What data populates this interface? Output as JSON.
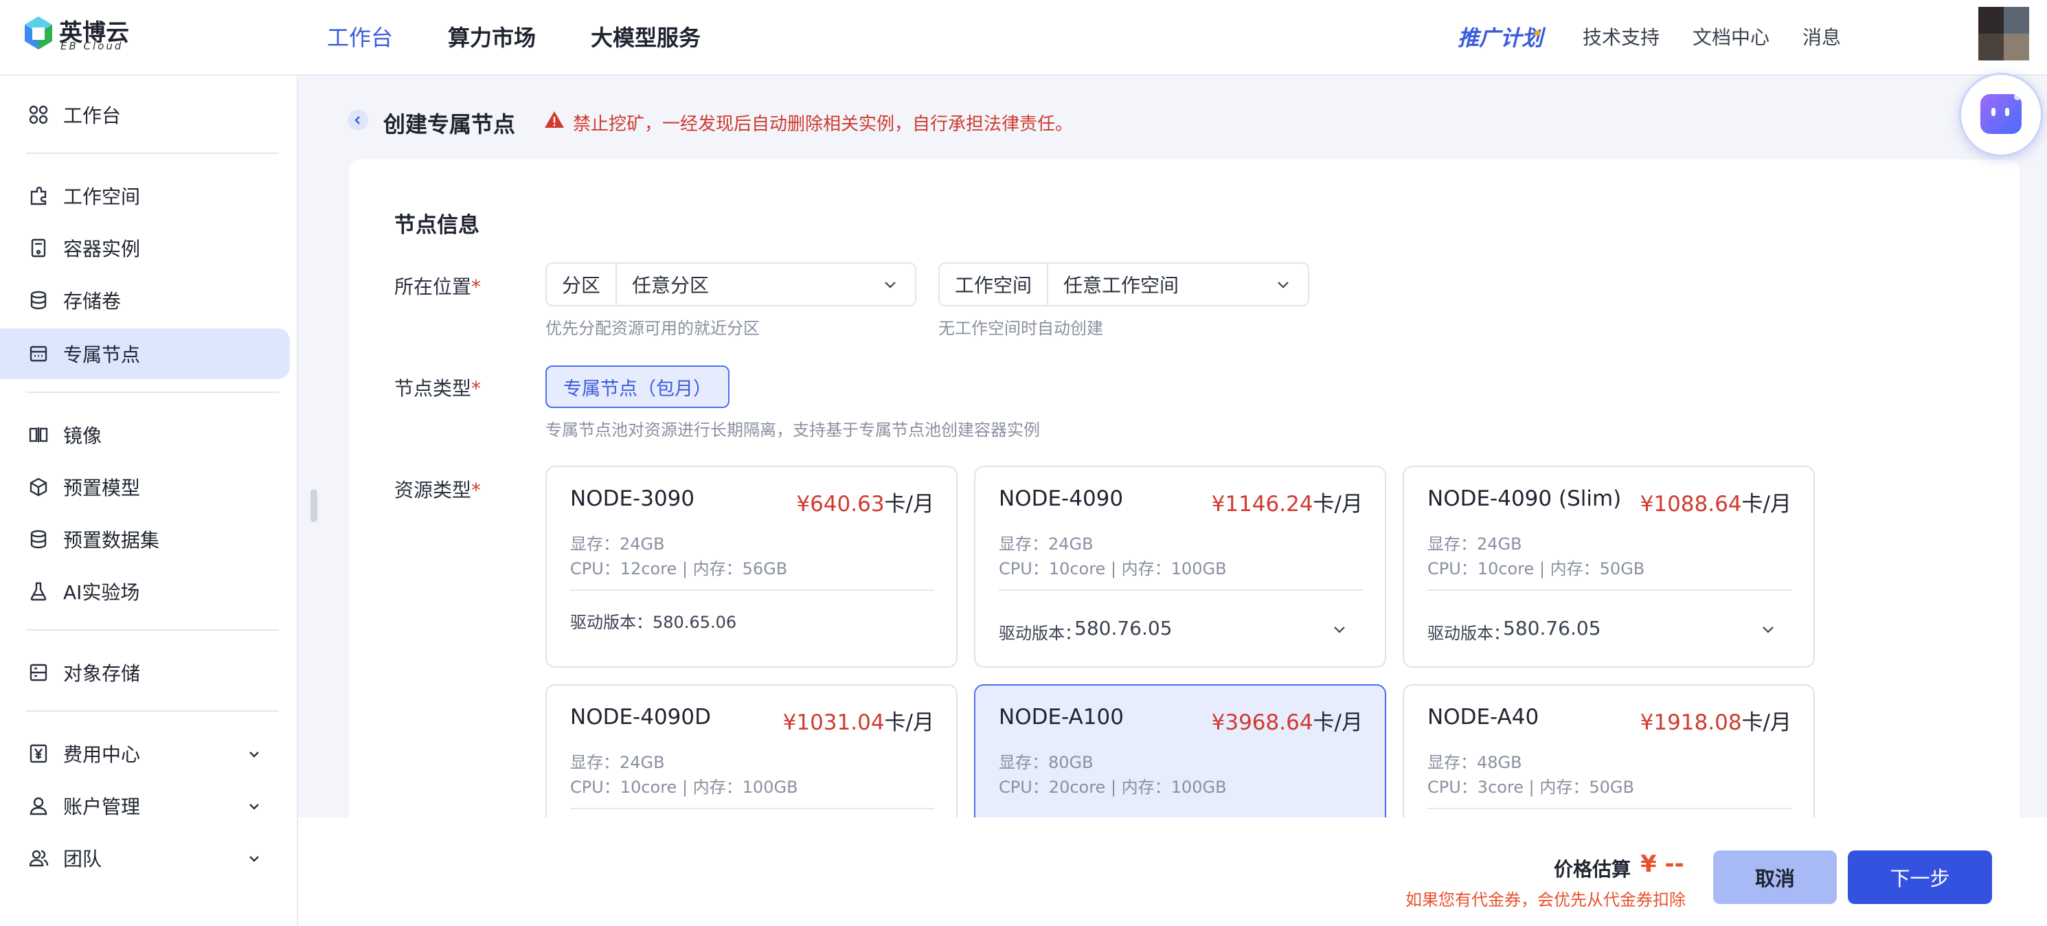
{
  "brand": {
    "name": "英博云",
    "sub": "EB Cloud"
  },
  "topnav": {
    "items": [
      {
        "label": "工作台"
      },
      {
        "label": "算力市场"
      },
      {
        "label": "大模型服务"
      }
    ],
    "promo": "推广计划",
    "links": [
      "技术支持",
      "文档中心",
      "消息"
    ]
  },
  "sidebar": {
    "items": [
      {
        "label": "工作台",
        "icon": "dashboard-icon"
      },
      {
        "label": "工作空间",
        "icon": "workspace-icon"
      },
      {
        "label": "容器实例",
        "icon": "container-icon"
      },
      {
        "label": "存储卷",
        "icon": "database-icon"
      },
      {
        "label": "专属节点",
        "icon": "node-icon"
      },
      {
        "label": "镜像",
        "icon": "image-icon"
      },
      {
        "label": "预置模型",
        "icon": "cube-icon"
      },
      {
        "label": "预置数据集",
        "icon": "dataset-icon"
      },
      {
        "label": "AI实验场",
        "icon": "flask-icon"
      },
      {
        "label": "对象存储",
        "icon": "object-storage-icon"
      },
      {
        "label": "费用中心",
        "icon": "yen-icon"
      },
      {
        "label": "账户管理",
        "icon": "user-icon"
      },
      {
        "label": "团队",
        "icon": "team-icon"
      }
    ]
  },
  "header": {
    "title": "创建专属节点",
    "warning": "禁止挖矿，一经发现后自动删除相关实例，自行承担法律责任。"
  },
  "form": {
    "section_title": "节点信息",
    "location": {
      "label": "所在位置",
      "required_mark": "*",
      "zone": {
        "prefix": "分区",
        "value": "任意分区",
        "hint": "优先分配资源可用的就近分区"
      },
      "workspace": {
        "prefix": "工作空间",
        "value": "任意工作空间",
        "hint": "无工作空间时自动创建"
      }
    },
    "node_type": {
      "label": "节点类型",
      "required_mark": "*",
      "option": "专属节点（包月）",
      "hint": "专属节点池对资源进行长期隔离，支持基于专属节点池创建容器实例"
    },
    "resource_type": {
      "label": "资源类型",
      "required_mark": "*",
      "unit": "卡/月",
      "driver_label": "驱动版本：",
      "cards": [
        {
          "name": "NODE-3090",
          "price": "¥640.63",
          "mem": "显存：24GB",
          "cpu": "CPU：12core | 内存：56GB",
          "driver": "580.65.06",
          "has_dropdown": false,
          "selected": false
        },
        {
          "name": "NODE-4090",
          "price": "¥1146.24",
          "mem": "显存：24GB",
          "cpu": "CPU：10core | 内存：100GB",
          "driver": "580.76.05",
          "has_dropdown": true,
          "selected": false
        },
        {
          "name": "NODE-4090 (Slim)",
          "price": "¥1088.64",
          "mem": "显存：24GB",
          "cpu": "CPU：10core | 内存：50GB",
          "driver": "580.76.05",
          "has_dropdown": true,
          "selected": false
        },
        {
          "name": "NODE-4090D",
          "price": "¥1031.04",
          "mem": "显存：24GB",
          "cpu": "CPU：10core | 内存：100GB",
          "selected": false
        },
        {
          "name": "NODE-A100",
          "price": "¥3968.64",
          "mem": "显存：80GB",
          "cpu": "CPU：20core | 内存：100GB",
          "selected": true
        },
        {
          "name": "NODE-A40",
          "price": "¥1918.08",
          "mem": "显存：48GB",
          "cpu": "CPU：3core | 内存：50GB",
          "selected": false
        }
      ]
    }
  },
  "footer": {
    "estimate_label": "价格估算",
    "estimate_value": "¥ --",
    "note": "如果您有代金券，会优先从代金券扣除",
    "cancel": "取消",
    "next": "下一步"
  },
  "colors": {
    "accent": "#3b5bdb",
    "price": "#d03a30",
    "estimate": "#e8512d",
    "selected_bg": "#e7edfd"
  }
}
